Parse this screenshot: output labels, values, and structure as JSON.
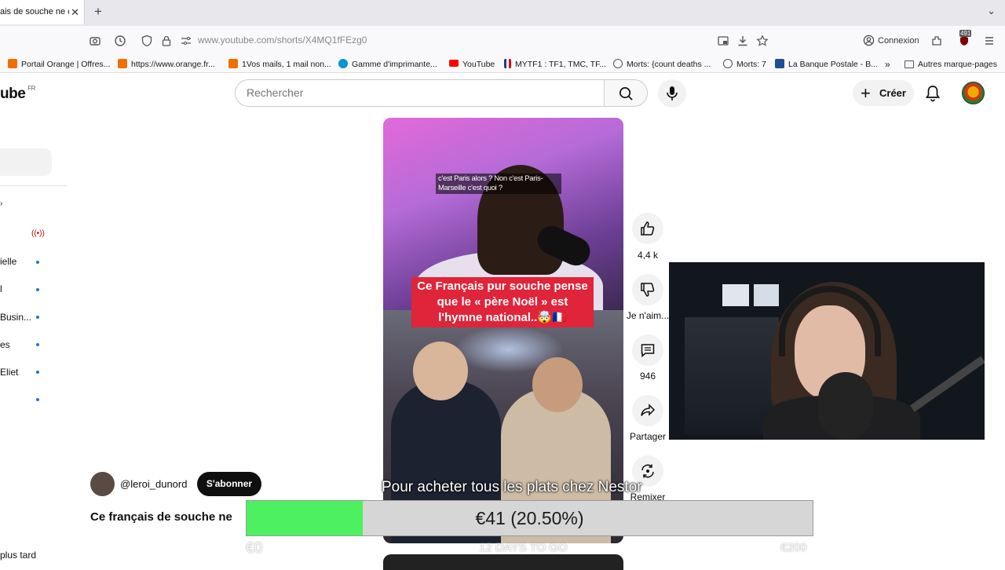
{
  "browser": {
    "tab_title": "ais de souche ne cc",
    "url": "www.youtube.com/shorts/X4MQ1fFEzg0",
    "connexion_label": "Connexion",
    "badge_count": "491",
    "bookmarks": [
      {
        "label": "Portail Orange | Offres...",
        "icon_color": "#f16e00"
      },
      {
        "label": "https://www.orange.fr...",
        "icon_color": "#f16e00"
      },
      {
        "label": "1Vos mails, 1 mail non...",
        "icon_color": "#f16e00"
      },
      {
        "label": "Gamme d'imprimante...",
        "icon_color": "#0096d6"
      },
      {
        "label": "YouTube",
        "icon_color": "#ff0000"
      },
      {
        "label": "MYTF1 : TF1, TMC, TF...",
        "icon_color": "#1d3b8c"
      },
      {
        "label": "Morts: {count deaths ...",
        "icon_color": "#555555"
      },
      {
        "label": "Morts: 7",
        "icon_color": "#555555"
      },
      {
        "label": "La Banque Postale - B...",
        "icon_color": "#1f4e99"
      }
    ],
    "other_bookmarks": "Autres marque-pages"
  },
  "youtube": {
    "logo_text": "ube",
    "logo_region": "FR",
    "search_placeholder": "Rechercher",
    "create_label": "Créer",
    "sidebar": {
      "items": [
        "ielle",
        "l",
        "Busin...",
        "es",
        "Eliet"
      ],
      "watch_later": "plus tard"
    },
    "short": {
      "caption_top": "c'est Paris alors ? Non c'est Paris-Marseille c'est quoi ?",
      "caption_main": "Ce Français pur souche pense que le « père Noël » est l'hymne national..🤯🇫🇷",
      "promo_text": "Pour acheter tous les plats chez Nestor",
      "channel": "@leroi_dunord",
      "subscribe_label": "S'abonner",
      "title": "Ce français de souche ne"
    },
    "actions": {
      "likes": "4,4 k",
      "dislike_label": "Je n'aim...",
      "comments": "946",
      "share_label": "Partager",
      "remix_label": "Remixer"
    }
  },
  "donation_goal": {
    "current": "€41 (20.50%)",
    "progress_fraction": 0.205,
    "min_label": "€0",
    "max_label": "€200",
    "deadline": "12 DAYS TO GO",
    "fill_color": "#4cf060"
  }
}
